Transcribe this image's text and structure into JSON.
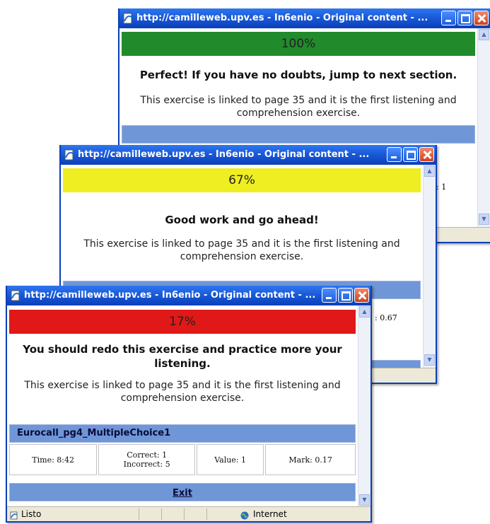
{
  "window_title": "http://camilleweb.upv.es - In6enio - Original content - ...",
  "info_text": "This exercise is linked to page 35 and it is the first listening and comprehension exercise.",
  "windows": [
    {
      "percent": "100%",
      "percent_color": "#218a2a",
      "message": "Perfect! If you have no doubts, jump to next section.",
      "partial_mark": "1"
    },
    {
      "percent": "67%",
      "percent_color": "#eeee22",
      "message": "Good work and go ahead!",
      "partial_mark": "0.67"
    },
    {
      "percent": "17%",
      "percent_color": "#e01818",
      "message": "You should redo this exercise and practice more your listening.",
      "exercise_name": "Eurocall_pg4_MultipleChoice1",
      "time": "Time: 8:42",
      "correct": "Correct: 1",
      "incorrect": "Incorrect: 5",
      "value": "Value: 1",
      "mark": "Mark: 0.17",
      "exit_label": "Exit",
      "status_left": "Listo",
      "status_zone": "Internet"
    }
  ]
}
